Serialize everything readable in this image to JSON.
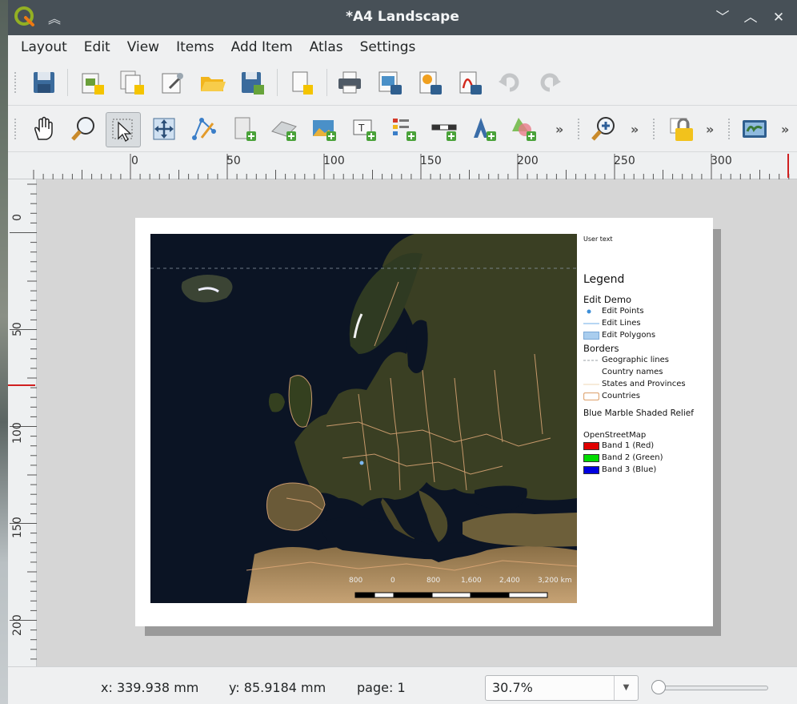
{
  "window": {
    "title": "*A4 Landscape",
    "controls": [
      "minimize",
      "maximize",
      "close"
    ]
  },
  "menubar": [
    "Layout",
    "Edit",
    "View",
    "Items",
    "Add Item",
    "Atlas",
    "Settings"
  ],
  "toolbar1": {
    "icons": [
      "save-icon",
      "new-layout-icon",
      "duplicate-layout-icon",
      "layout-manager-icon",
      "open-template-icon",
      "save-template-icon",
      "add-pages-icon",
      "print-icon",
      "export-image-icon",
      "export-svg-icon",
      "export-pdf-icon",
      "undo-icon",
      "redo-icon"
    ]
  },
  "toolbar2": {
    "icons": [
      "pan-icon",
      "zoom-tool-icon",
      "select-move-icon",
      "move-content-icon",
      "edit-nodes-icon",
      "add-map-icon",
      "add-3d-map-icon",
      "add-picture-icon",
      "add-label-icon",
      "add-legend-icon",
      "add-scalebar-icon",
      "add-north-arrow-icon",
      "add-shape-icon",
      "zoom-full-icon",
      "lock-items-icon",
      "atlas-icon"
    ],
    "overflow": "»"
  },
  "ruler_h": {
    "labels": [
      "0",
      "50",
      "100",
      "150",
      "200",
      "250",
      "300"
    ]
  },
  "ruler_v": {
    "labels": [
      "0",
      "50",
      "100",
      "150",
      "200"
    ]
  },
  "layout": {
    "user_text": "User text",
    "legend": {
      "title": "Legend",
      "groups": [
        {
          "name": "Edit Demo",
          "items": [
            {
              "label": "Edit Points",
              "symbol": "point",
              "color": "#3d8fd8"
            },
            {
              "label": "Edit Lines",
              "symbol": "line",
              "color": "#9ec9ef"
            },
            {
              "label": "Edit Polygons",
              "symbol": "polygon",
              "color": "#a9cdee"
            }
          ]
        },
        {
          "name": "Borders",
          "items": [
            {
              "label": "Geographic lines",
              "symbol": "dashed-line",
              "color": "#9aa0a6"
            },
            {
              "label": "Country names",
              "symbol": "none",
              "color": ""
            },
            {
              "label": "States and Provinces",
              "symbol": "line",
              "color": "#f2dfc4"
            },
            {
              "label": "Countries",
              "symbol": "outline",
              "color": "#e0a978"
            }
          ]
        },
        {
          "name": "Blue Marble Shaded Relief",
          "items": []
        },
        {
          "name": "OpenStreetMap",
          "items": [
            {
              "label": "Band 1 (Red)",
              "symbol": "fill",
              "color": "#e00000"
            },
            {
              "label": "Band 2 (Green)",
              "symbol": "fill",
              "color": "#00dc00"
            },
            {
              "label": "Band 3 (Blue)",
              "symbol": "fill",
              "color": "#0000e0"
            }
          ]
        }
      ]
    },
    "scalebar": {
      "labels": [
        "800",
        "0",
        "800",
        "1,600",
        "2,400",
        "3,200 km"
      ]
    }
  },
  "statusbar": {
    "x": "x: 339.938 mm",
    "y": "y: 85.9184 mm",
    "page": "page: 1",
    "zoom": "30.7%",
    "zoom_slider_fraction": 0.0
  }
}
